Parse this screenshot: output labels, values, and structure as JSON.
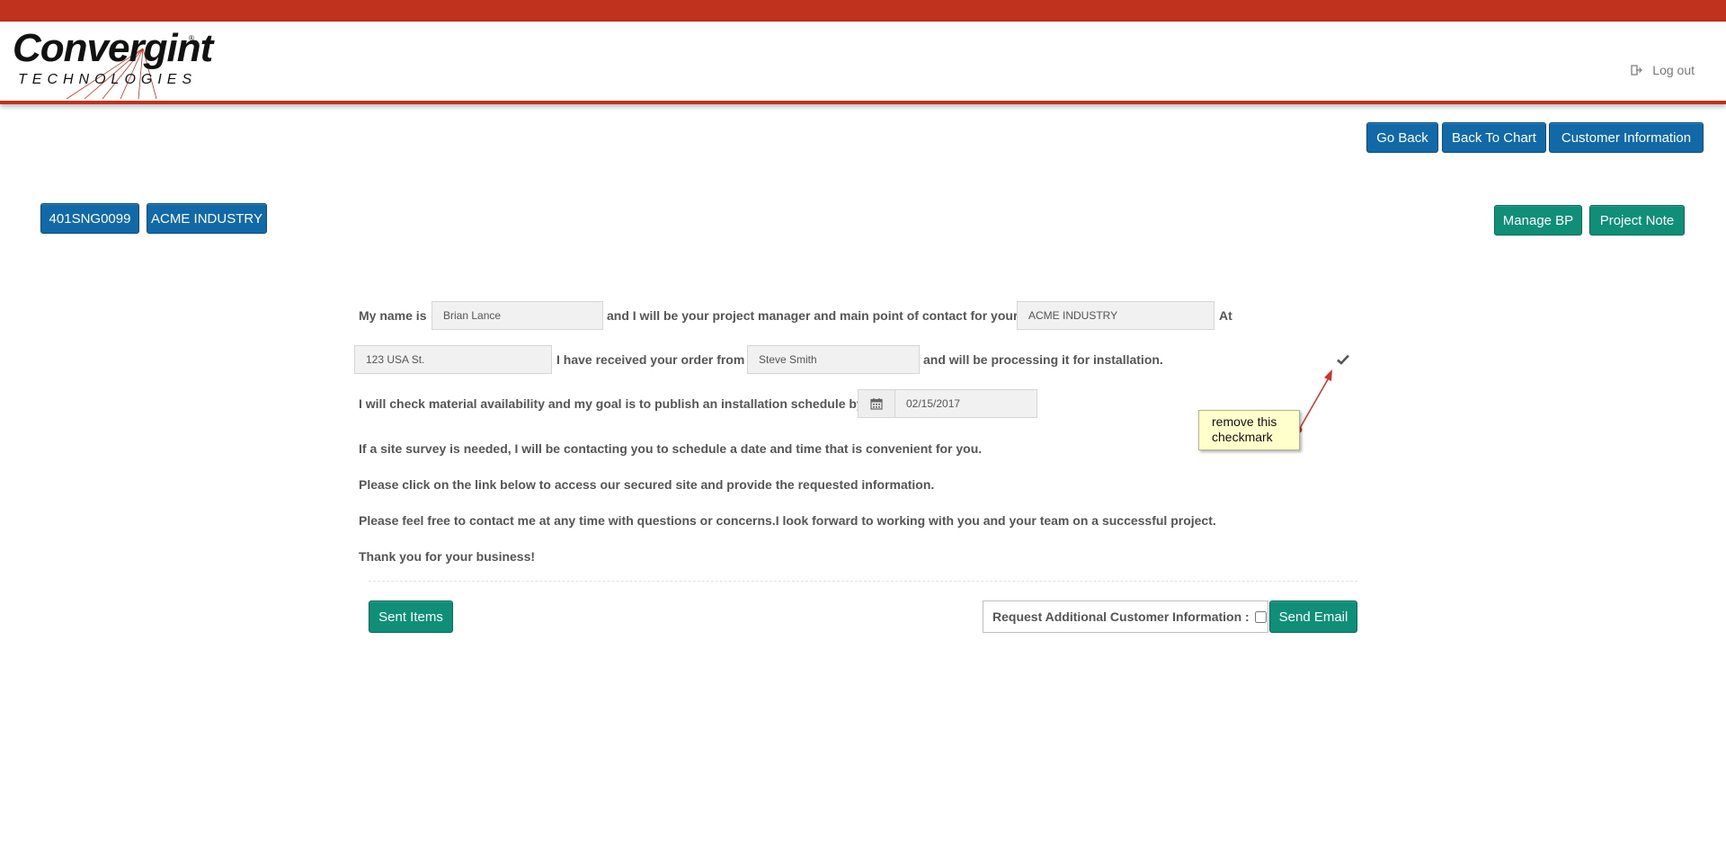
{
  "header": {
    "logo_main": "Convergint",
    "logo_sub": "TECHNOLOGIES",
    "logo_reg": "®",
    "logout_label": "Log out"
  },
  "top_actions": {
    "go_back": "Go Back",
    "back_to_chart": "Back To Chart",
    "customer_information": "Customer Information"
  },
  "project": {
    "id": "401SNG0099",
    "customer": "ACME INDUSTRY",
    "manage_bp": "Manage BP",
    "project_note": "Project Note"
  },
  "letter": {
    "my_name_is": "My name is",
    "name_value": "Brian Lance",
    "pm_text": "and I will be your project manager and main point of contact for your",
    "company_value": "ACME INDUSTRY",
    "at": "At",
    "address_value": "123 USA St.",
    "received_text": "I have received your order from",
    "orderer_value": "Steve Smith",
    "processing_text": "and will be processing it for installation.",
    "check_text": "I will check material availability and my goal is to publish an installation schedule by",
    "date_value": "02/15/2017",
    "survey_text": "If a site survey is needed, I will be contacting you to schedule a date and time that is convenient for you.",
    "link_text": "Please click on the link below to access our secured site and provide the requested information.",
    "contact_text": "Please feel free to contact me at any time with questions or concerns.I look forward to working with you and your team on a successful project.",
    "thanks_text": "Thank you for your business!"
  },
  "footer": {
    "sent_items": "Sent Items",
    "request_label": "Request Additional Customer Information :",
    "send_email": "Send Email"
  },
  "annotation": {
    "note_text": "remove this checkmark"
  },
  "colors": {
    "brand_red": "#c0311e",
    "primary_blue": "#1169a8",
    "success_green": "#0f8f78"
  }
}
